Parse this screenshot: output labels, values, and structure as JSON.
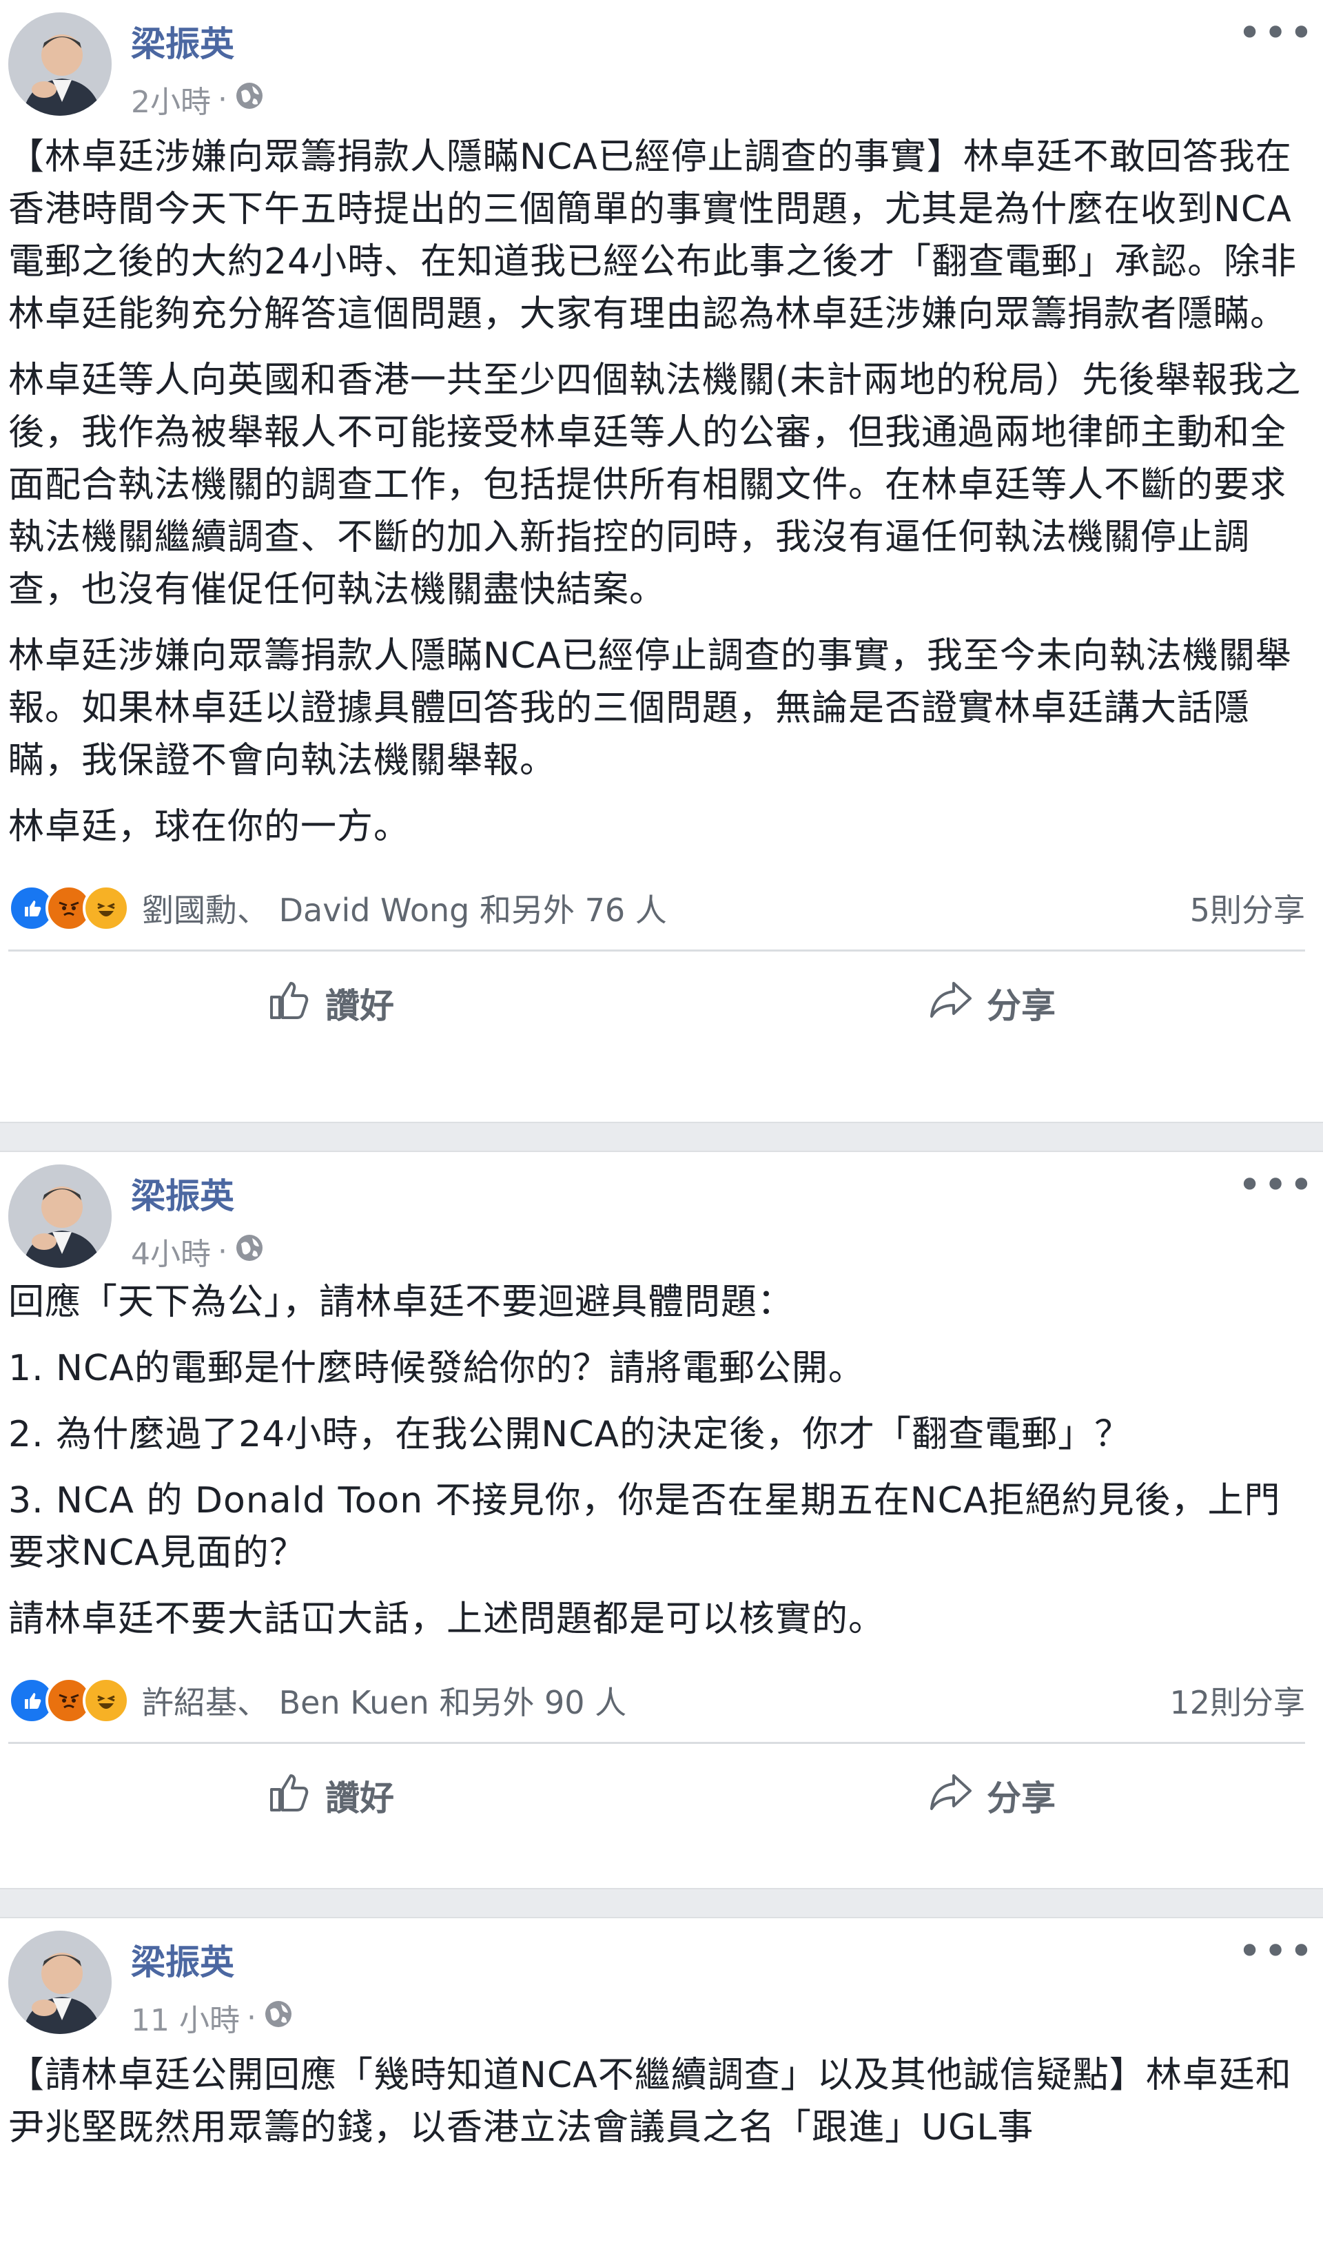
{
  "posts": [
    {
      "author": "梁振英",
      "time": "2小時",
      "separator": "·",
      "paragraphs": [
        "【林卓廷涉嫌向眾籌捐款人隱瞞NCA已經停止調查的事實】林卓廷不敢回答我在香港時間今天下午五時提出的三個簡單的事實性問題，尤其是為什麼在收到NCA電郵之後的大約24小時、在知道我已經公布此事之後才「翻查電郵」承認。除非林卓廷能夠充分解答這個問題，大家有理由認為林卓廷涉嫌向眾籌捐款者隱瞞。",
        "林卓廷等人向英國和香港一共至少四個執法機關(未計兩地的稅局）先後舉報我之後，我作為被舉報人不可能接受林卓廷等人的公審，但我通過兩地律師主動和全面配合執法機關的調查工作，包括提供所有相關文件。在林卓廷等人不斷的要求執法機關繼續調查、不斷的加入新指控的同時，我沒有逼任何執法機關停止調查，也沒有催促任何執法機關盡快結案。",
        "林卓廷涉嫌向眾籌捐款人隱瞞NCA已經停止調查的事實，我至今未向執法機關舉報。如果林卓廷以證據具體回答我的三個問題，無論是否證實林卓廷講大話隱瞞，我保證不會向執法機關舉報。",
        "林卓廷，球在你的一方。"
      ],
      "reaction_names": "劉國勳、 David Wong 和另外 76 人",
      "shares": "5則分享",
      "like_label": "讚好",
      "share_label": "分享"
    },
    {
      "author": "梁振英",
      "time": "4小時",
      "separator": "·",
      "paragraphs": [
        "回應「天下為公」，請林卓廷不要迴避具體問題：",
        "1. NCA的電郵是什麼時候發給你的？請將電郵公開。",
        "2. 為什麼過了24小時，在我公開NCA的決定後，你才「翻查電郵」？",
        "3. NCA 的 Donald Toon 不接見你，你是否在星期五在NCA拒絕約見後，上門要求NCA見面的？",
        "請林卓廷不要大話冚大話，上述問題都是可以核實的。"
      ],
      "reaction_names": "許紹基、 Ben Kuen 和另外 90 人",
      "shares": "12則分享",
      "like_label": "讚好",
      "share_label": "分享"
    },
    {
      "author": "梁振英",
      "time": "11 小時",
      "separator": "·",
      "paragraphs": [
        "【請林卓廷公開回應「幾時知道NCA不繼續調查」以及其他誠信疑點】林卓廷和尹兆堅既然用眾籌的錢，以香港立法會議員之名「跟進」UGL事"
      ]
    }
  ],
  "icons": {
    "globe": "globe-icon",
    "more": "more-icon",
    "like": "like-icon",
    "share": "share-icon",
    "reaction_like": "like-reaction-icon",
    "reaction_angry": "angry-reaction-icon",
    "reaction_haha": "haha-reaction-icon"
  },
  "colors": {
    "author": "#4b67a1",
    "meta": "#90949c",
    "text": "#1d2129",
    "like_blue": "#1877f2",
    "angry": "#e9710f",
    "haha": "#f7b125"
  }
}
